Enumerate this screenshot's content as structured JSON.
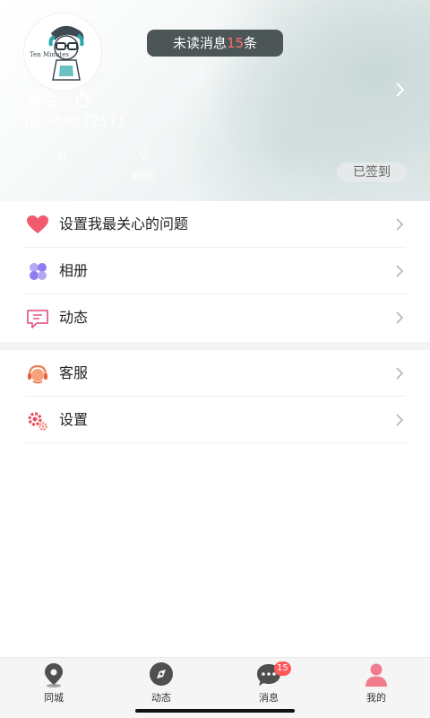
{
  "header": {
    "unread_prefix": "未读消息",
    "unread_count": "15",
    "unread_suffix": "条",
    "username": "男主",
    "user_id": "ID:966372371",
    "stats": [
      {
        "value": "0",
        "label": ""
      },
      {
        "value": "0",
        "label": "粉丝"
      }
    ],
    "checkin_label": "已签到",
    "avatar_text": "Ten Minutes"
  },
  "menu_group_1": [
    {
      "label": "设置我最关心的问题",
      "icon": "heart-icon"
    },
    {
      "label": "相册",
      "icon": "album-icon"
    },
    {
      "label": "动态",
      "icon": "chat-bubble-icon"
    }
  ],
  "menu_group_2": [
    {
      "label": "客服",
      "icon": "customer-service-icon"
    },
    {
      "label": "设置",
      "icon": "gear-icon"
    }
  ],
  "bottom_nav": {
    "items": [
      {
        "label": "同城",
        "icon": "location-pin-icon"
      },
      {
        "label": "动态",
        "icon": "compass-icon"
      },
      {
        "label": "消息",
        "icon": "message-icon",
        "badge": "15"
      },
      {
        "label": "我的",
        "icon": "user-icon"
      }
    ]
  },
  "colors": {
    "accent_red": "#ff5a5a",
    "heart": "#f25a6e",
    "album": "#9b8df0",
    "pill_bg": "#4d5656"
  }
}
